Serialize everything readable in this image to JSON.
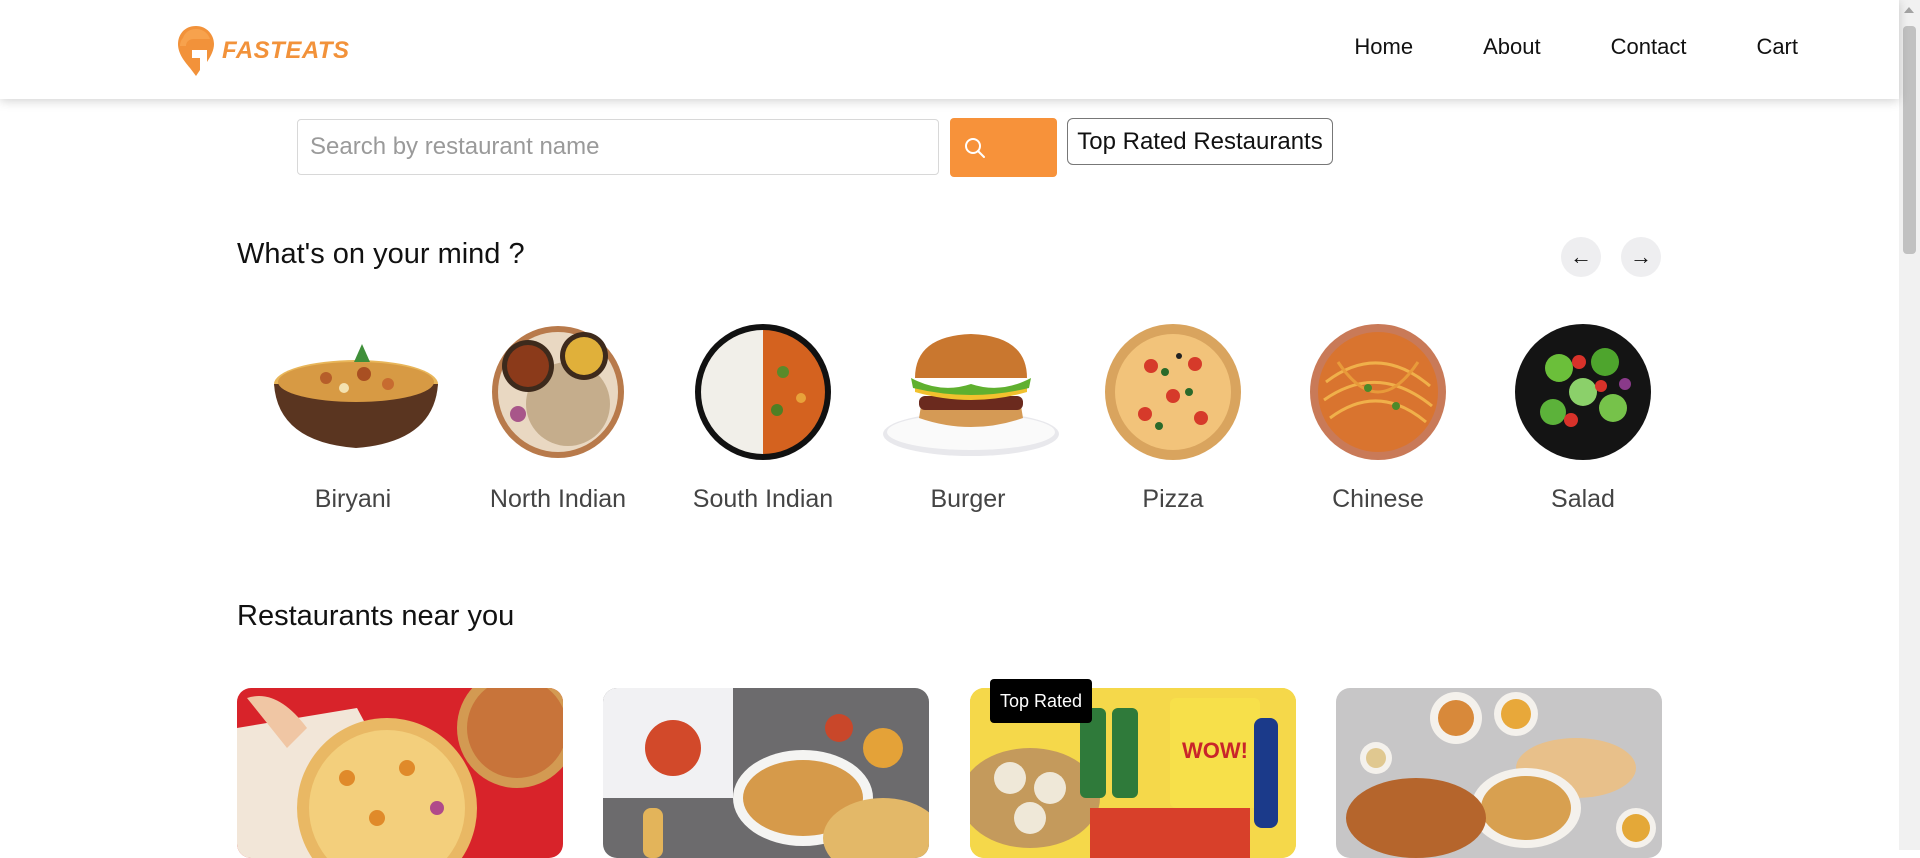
{
  "brand": {
    "name": "FASTEATS",
    "color": "#f2923a"
  },
  "nav": {
    "items": [
      "Home",
      "About",
      "Contact",
      "Cart"
    ]
  },
  "search": {
    "placeholder": "Search by restaurant name",
    "button_icon": "search-icon",
    "button_color": "#f7923a"
  },
  "filter": {
    "top_rated_label": "Top Rated Restaurants"
  },
  "mind_section": {
    "title": "What's on your mind ?",
    "prev_icon": "←",
    "next_icon": "→",
    "categories": [
      "Biryani",
      "North Indian",
      "South Indian",
      "Burger",
      "Pizza",
      "Chinese",
      "Salad"
    ]
  },
  "restaurants_section": {
    "title": "Restaurants near you",
    "badge": "Top Rated"
  }
}
